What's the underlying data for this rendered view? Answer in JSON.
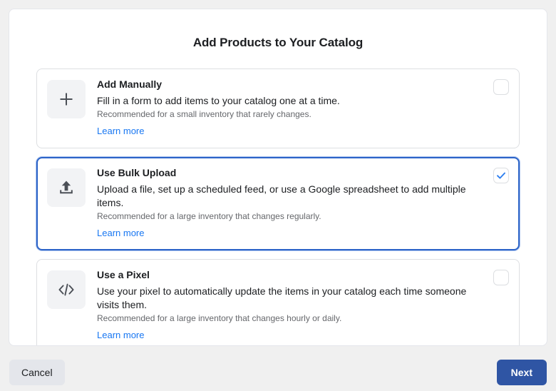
{
  "dialog": {
    "title": "Add Products to Your Catalog"
  },
  "options": [
    {
      "id": "add-manually",
      "icon": "plus-icon",
      "title": "Add Manually",
      "description": "Fill in a form to add items to your catalog one at a time.",
      "recommendation": "Recommended for a small inventory that rarely changes.",
      "link_label": "Learn more",
      "selected": false
    },
    {
      "id": "use-bulk-upload",
      "icon": "upload-icon",
      "title": "Use Bulk Upload",
      "description": "Upload a file, set up a scheduled feed, or use a Google spreadsheet to add multiple items.",
      "recommendation": "Recommended for a large inventory that changes regularly.",
      "link_label": "Learn more",
      "selected": true
    },
    {
      "id": "use-a-pixel",
      "icon": "code-icon",
      "title": "Use a Pixel",
      "description": "Use your pixel to automatically update the items in your catalog each time someone visits them.",
      "recommendation": "Recommended for a large inventory that changes hourly or daily.",
      "link_label": "Learn more",
      "selected": false
    }
  ],
  "footer": {
    "cancel_label": "Cancel",
    "next_label": "Next"
  },
  "colors": {
    "page_background": "#f0f0f0",
    "panel_background": "#ffffff",
    "selected_border": "#2d64c8",
    "link": "#1877f2",
    "primary_button": "#2f55a4",
    "secondary_button": "#e4e6eb",
    "checkmark": "#2d7ff0",
    "icon_tile": "#f2f3f5"
  }
}
